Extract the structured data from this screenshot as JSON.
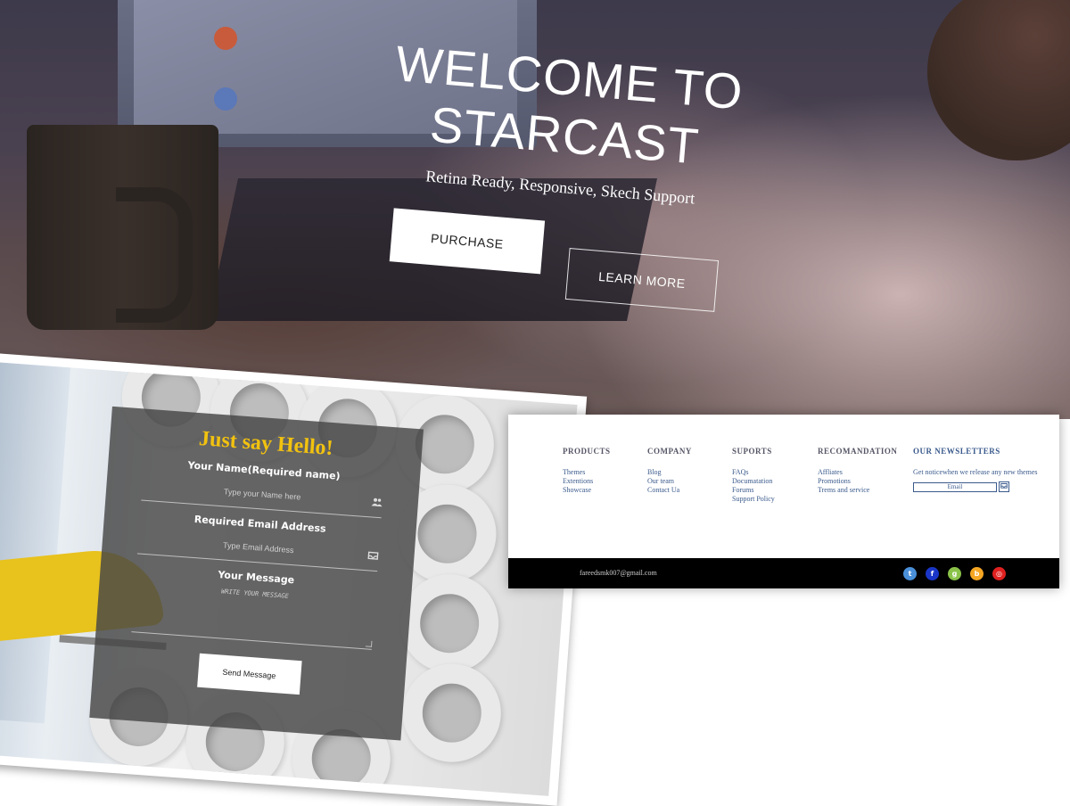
{
  "hero": {
    "title": "WELCOME TO STARCAST",
    "subtitle": "Retina Ready, Responsive, Skech Support",
    "purchase_label": "PURCHASE",
    "learn_more_label": "LEARN MORE"
  },
  "contact": {
    "title": "Just say Hello!",
    "name_label": "Your Name(Required name)",
    "name_placeholder": "Type your Name here",
    "email_label": "Required Email Address",
    "email_placeholder": "Type Email Address",
    "message_label": "Your Message",
    "message_placeholder": "WRITE YOUR MESSAGE",
    "send_label": "Send Message",
    "name_icon": "users-icon",
    "email_icon": "inbox-icon"
  },
  "footer": {
    "columns": [
      {
        "heading": "PRODUCTS",
        "items": [
          "Themes",
          "Extentions",
          "Showcase"
        ]
      },
      {
        "heading": "COMPANY",
        "items": [
          "Blog",
          "Our team",
          "Contact Ua"
        ]
      },
      {
        "heading": "SUPORTS",
        "items": [
          "FAQs",
          "Documatation",
          "Forums",
          "Support Policy"
        ]
      },
      {
        "heading": "RECOMANDATION",
        "items": [
          "Affliates",
          "Promotions",
          "Trems and service"
        ]
      }
    ],
    "newsletter": {
      "heading": "OUR NEWSLETTERS",
      "text": "Get noticewhen we release any new themes",
      "input_value": "Email",
      "button_icon": "inbox-icon"
    },
    "email": "fareedsmk007@gmail.com",
    "social": [
      {
        "icon": "twitter-icon",
        "glyph": "t",
        "color": "#4a90d9"
      },
      {
        "icon": "facebook-icon",
        "glyph": "f",
        "color": "#1a36c8"
      },
      {
        "icon": "google-plus-icon",
        "glyph": "g",
        "color": "#8bc34a"
      },
      {
        "icon": "blogger-icon",
        "glyph": "b",
        "color": "#f5a623"
      },
      {
        "icon": "instagram-icon",
        "glyph": "◎",
        "color": "#e02020"
      }
    ]
  }
}
